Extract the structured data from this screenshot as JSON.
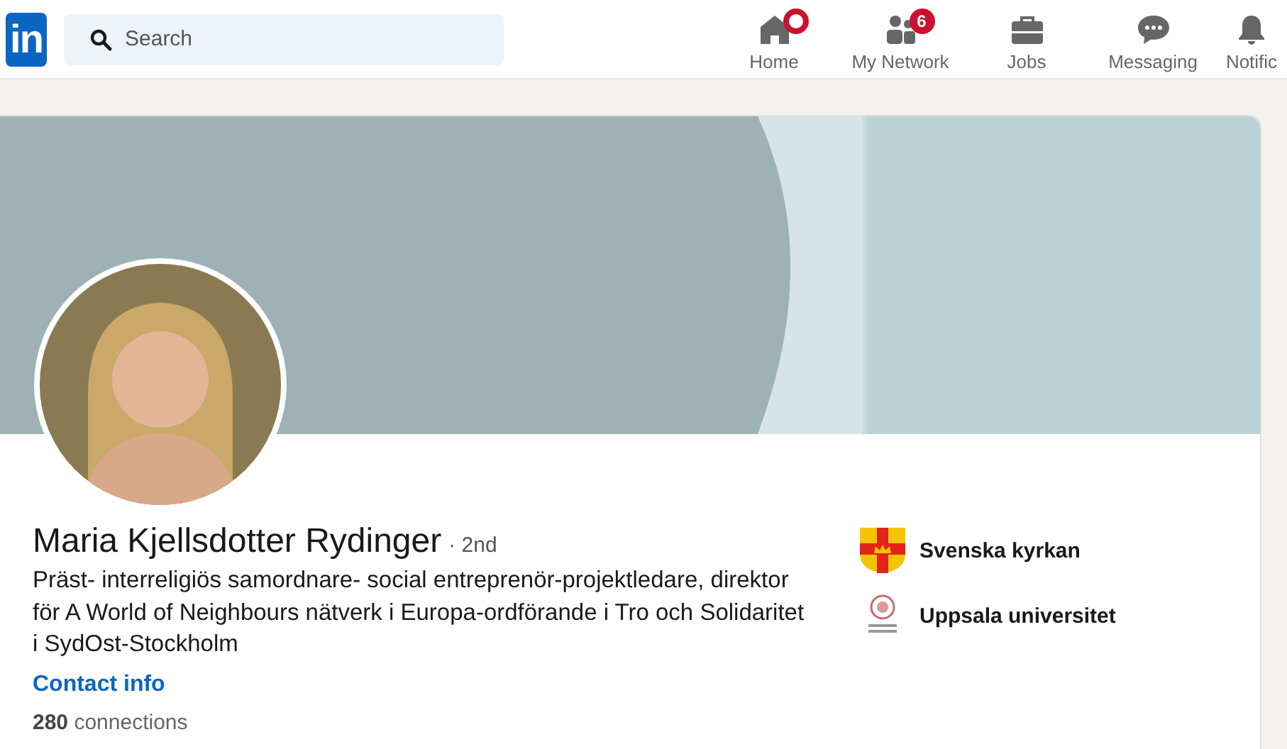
{
  "logo": "in",
  "search": {
    "placeholder": "Search"
  },
  "nav": [
    {
      "kind": "home",
      "label": "Home",
      "dot": true
    },
    {
      "kind": "network",
      "label": "My Network",
      "dot": false,
      "badge": "6"
    },
    {
      "kind": "jobs",
      "label": "Jobs",
      "dot": false
    },
    {
      "kind": "messaging",
      "label": "Messaging",
      "dot": false
    },
    {
      "kind": "notifications",
      "label": "Notific",
      "dot": false
    }
  ],
  "profile": {
    "name": "Maria Kjellsdotter Rydinger",
    "degree": "· 2nd",
    "headline": "Präst- interreligiös samordnare- social entreprenör-projektledare, direktor för A World of Neighbours nätverk i Europa-ordförande i Tro och Solidaritet i SydOst-Stockholm",
    "contact": "Contact info",
    "connections": "**280** connections"
  },
  "organizations": [
    {
      "kind": "church",
      "name": "Svenska kyrkan"
    },
    {
      "kind": "university",
      "name": "Uppsala universitet"
    }
  ]
}
